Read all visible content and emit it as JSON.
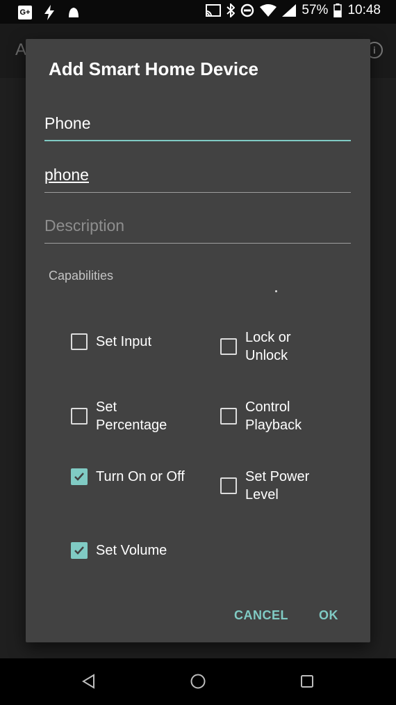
{
  "status_bar": {
    "left_icons": [
      "google-plus-icon",
      "flash-icon",
      "notification-blob-icon"
    ],
    "right_icons": [
      "cast-icon",
      "bluetooth-icon",
      "do-not-disturb-icon",
      "wifi-icon",
      "signal-icon",
      "battery-icon"
    ],
    "battery": "57%",
    "time": "10:48"
  },
  "background_app": {
    "title_fragment": "A"
  },
  "dialog": {
    "title": "Add Smart Home Device",
    "fields": {
      "name": {
        "value": "Phone",
        "placeholder": ""
      },
      "id": {
        "value": "phone",
        "placeholder": ""
      },
      "description": {
        "value": "",
        "placeholder": "Description"
      }
    },
    "capabilities_label": "Capabilities",
    "capabilities": [
      {
        "label": "Set Input",
        "checked": false
      },
      {
        "label": "Lock or Unlock",
        "checked": false
      },
      {
        "label": "Set Percentage",
        "checked": false
      },
      {
        "label": "Control Playback",
        "checked": false
      },
      {
        "label": "Turn On or Off",
        "checked": true
      },
      {
        "label": "Set Power Level",
        "checked": false
      },
      {
        "label": "Set Volume",
        "checked": true
      }
    ],
    "cancel_label": "CANCEL",
    "ok_label": "OK"
  },
  "colors": {
    "accent": "#80cbc4",
    "dialog_bg": "#424242"
  }
}
